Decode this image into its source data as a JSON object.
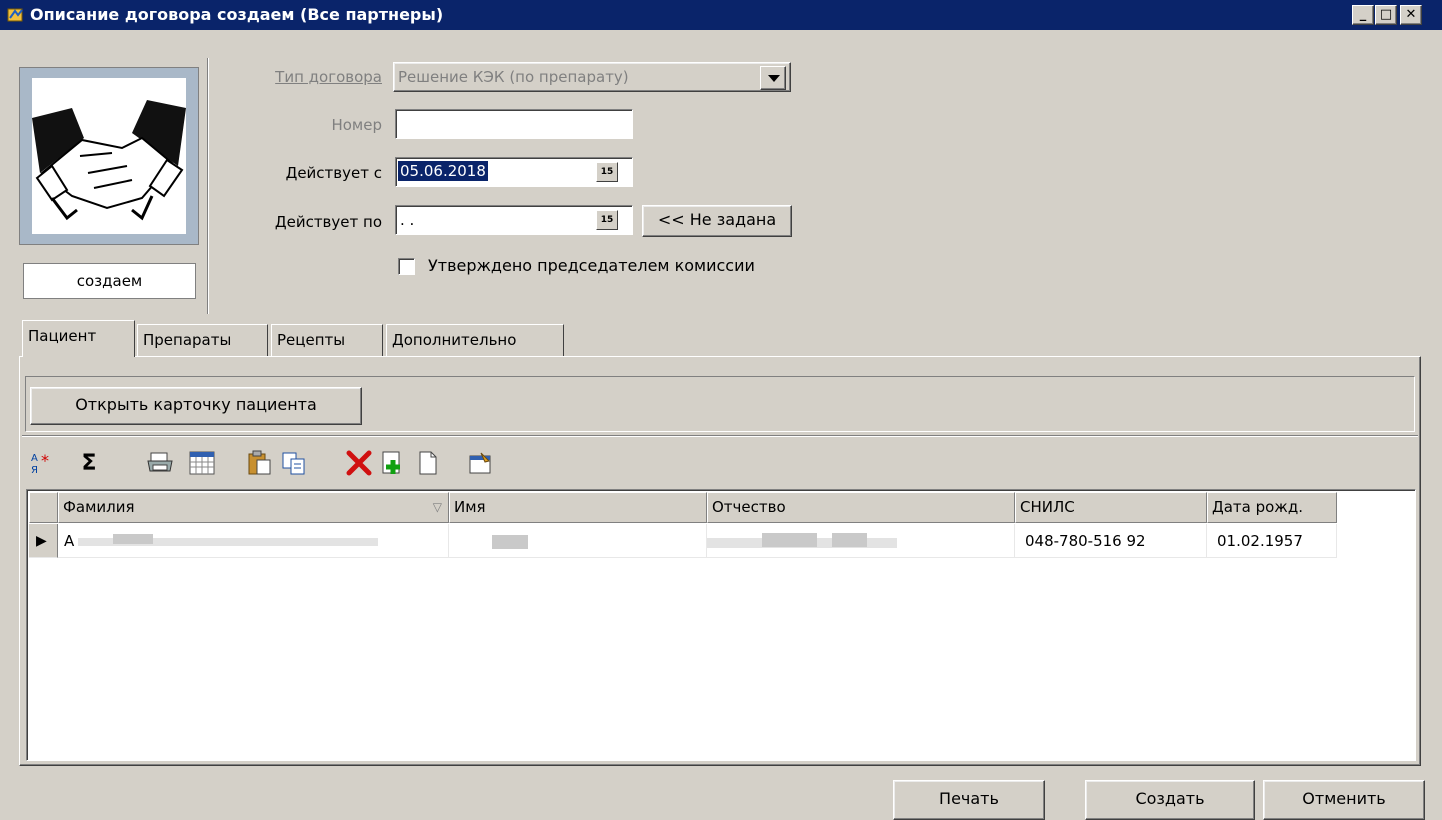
{
  "window": {
    "title": "Описание договора создаем (Все партнеры)",
    "min_glyph": "_",
    "max_glyph": "□",
    "close_glyph": "✕"
  },
  "status_box": "создаем",
  "form": {
    "contract_type_label": "Тип договора",
    "contract_type_value": "Решение КЭК (по препарату)",
    "number_label": "Номер",
    "number_value": "",
    "valid_from_label": "Действует с",
    "valid_from_value": "05.06.2018",
    "valid_to_label": "Действует по",
    "valid_to_value": " .  .",
    "not_set_button": "<< Не задана",
    "calendar_glyph": "15",
    "approved_label": "Утверждено председателем комиссии",
    "approved_checked": false
  },
  "tabs": [
    {
      "label": "Пациент",
      "active": true
    },
    {
      "label": "Препараты",
      "active": false
    },
    {
      "label": "Рецепты",
      "active": false
    },
    {
      "label": "Дополнительно",
      "active": false
    }
  ],
  "open_card_button": "Открыть карточку пациента",
  "toolbar": {
    "icons": [
      "sort-icon",
      "sum-icon",
      "print-icon",
      "calendar-grid-icon",
      "paste-icon",
      "copy-icon",
      "delete-icon",
      "add-icon",
      "new-document-icon",
      "properties-icon"
    ],
    "sum_glyph": "Σ"
  },
  "grid": {
    "columns": [
      "Фамилия",
      "Имя",
      "Отчество",
      "СНИЛС",
      "Дата рожд."
    ],
    "rows": [
      {
        "surname": "А",
        "name": "",
        "patronymic": "",
        "snils": "048-780-516 92",
        "birth_date": "01.02.1957"
      }
    ],
    "row_marker": "▶"
  },
  "footer": {
    "print_button": "Печать",
    "create_button": "Создать",
    "cancel_button": "Отменить"
  }
}
